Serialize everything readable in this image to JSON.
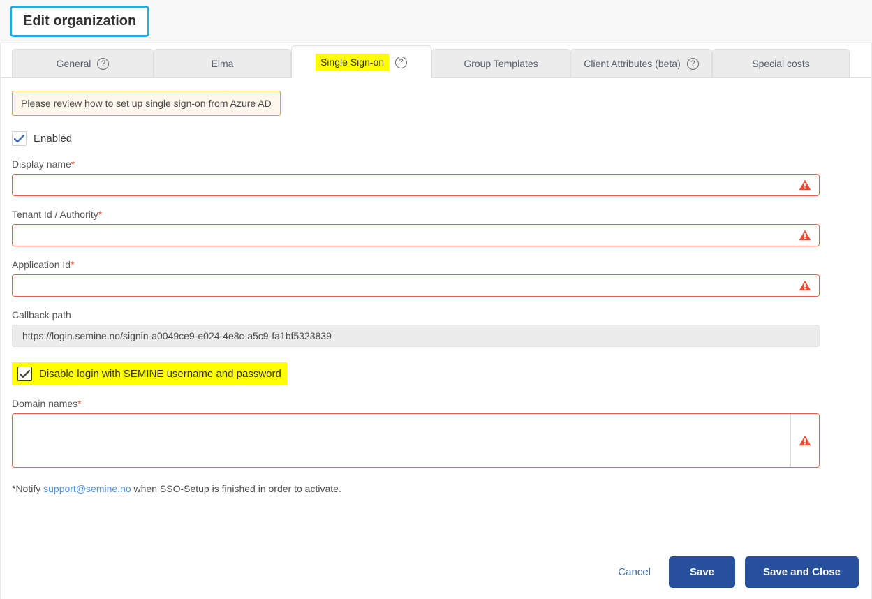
{
  "header": {
    "title": "Edit organization"
  },
  "tabs": [
    {
      "label": "General",
      "help": true,
      "active": false,
      "highlight": false,
      "icon": "help-icon"
    },
    {
      "label": "Elma",
      "help": false,
      "active": false,
      "highlight": false
    },
    {
      "label": "Single Sign-on",
      "help": true,
      "active": true,
      "highlight": true,
      "icon": "help-icon"
    },
    {
      "label": "Group Templates",
      "help": false,
      "active": false,
      "highlight": false
    },
    {
      "label": "Client Attributes (beta)",
      "help": true,
      "active": false,
      "highlight": false,
      "icon": "help-icon"
    },
    {
      "label": "Special costs",
      "help": false,
      "active": false,
      "highlight": false
    }
  ],
  "notice": {
    "prefix": "Please review ",
    "link_text": "how to set up single sign-on from Azure AD"
  },
  "enabled_checkbox": {
    "label": "Enabled",
    "checked": true,
    "icon": "checkmark-icon"
  },
  "fields": {
    "display_name": {
      "label": "Display name",
      "required_marker": "*",
      "value": "",
      "placeholder": "",
      "error_icon": "warning-triangle-icon"
    },
    "tenant_id": {
      "label": "Tenant Id / Authority",
      "required_marker": "*",
      "value": "",
      "placeholder": "",
      "error_icon": "warning-triangle-icon"
    },
    "application_id": {
      "label": "Application Id",
      "required_marker": "*",
      "value": "",
      "placeholder": "",
      "error_icon": "warning-triangle-icon"
    },
    "callback_path": {
      "label": "Callback path",
      "value": "https://login.semine.no/signin-a0049ce9-e024-4e8c-a5c9-fa1bf5323839"
    },
    "domain_names": {
      "label": "Domain names",
      "required_marker": "*",
      "value": "",
      "placeholder": "",
      "error_icon": "warning-triangle-icon"
    }
  },
  "disable_login_checkbox": {
    "label": "Disable login with SEMINE username and password",
    "checked": true,
    "icon": "checkmark-icon",
    "highlighted": true
  },
  "notify": {
    "prefix": "*Notify ",
    "email": "support@semine.no",
    "suffix": " when SSO-Setup is finished in order to activate."
  },
  "footer": {
    "cancel_label": "Cancel",
    "save_label": "Save",
    "save_close_label": "Save and Close"
  },
  "colors": {
    "title_border": "#29a9e1",
    "highlight": "#ffff00",
    "error_border": "#ee6044",
    "error_icon": "#ef4b33",
    "primary_button": "#26509b",
    "notice_border": "#d9a441",
    "notice_background": "#fdf7ec",
    "link": "#4a8fe0",
    "check_blue": "#3b6fb5"
  }
}
